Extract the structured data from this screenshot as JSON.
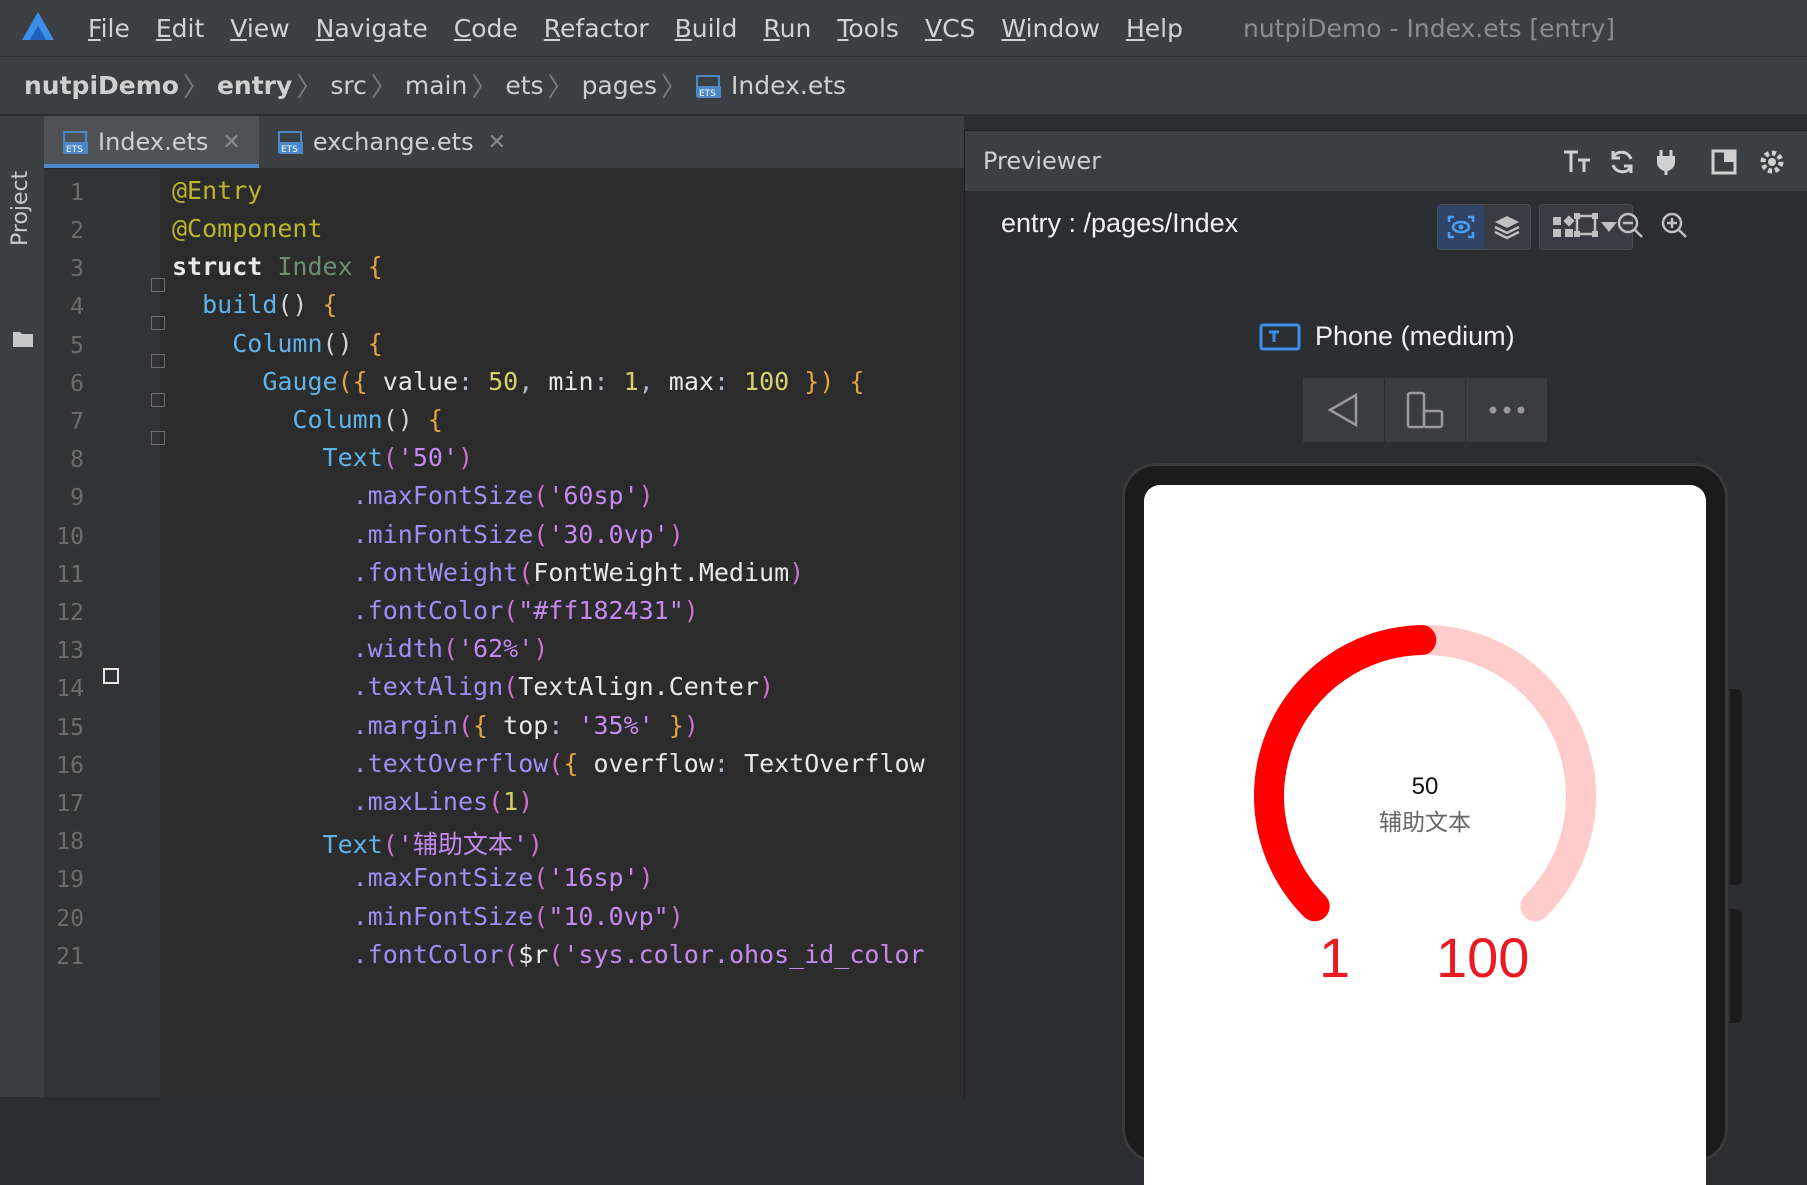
{
  "menu": {
    "items": [
      "File",
      "Edit",
      "View",
      "Navigate",
      "Code",
      "Refactor",
      "Build",
      "Run",
      "Tools",
      "VCS",
      "Window",
      "Help"
    ],
    "window_title": "nutpiDemo - Index.ets [entry]"
  },
  "breadcrumb": [
    "nutpiDemo",
    "entry",
    "src",
    "main",
    "ets",
    "pages",
    "Index.ets"
  ],
  "toolstrip": {
    "project_label": "Project"
  },
  "tabs": [
    {
      "label": "Index.ets",
      "active": true
    },
    {
      "label": "exchange.ets",
      "active": false
    }
  ],
  "editor": {
    "line_numbers": [
      "1",
      "2",
      "3",
      "4",
      "5",
      "6",
      "7",
      "8",
      "9",
      "10",
      "11",
      "12",
      "13",
      "14",
      "15",
      "16",
      "17",
      "18",
      "19",
      "20",
      "21"
    ]
  },
  "previewer": {
    "title": "Previewer",
    "route": "entry : /pages/Index",
    "device": "Phone (medium)",
    "gauge": {
      "value": 50,
      "min": 1,
      "max": 100,
      "value_text": "50",
      "aux_text": "辅助文本",
      "min_text": "1",
      "max_text": "100",
      "track_color": "#ffcccc",
      "progress_color": "#ff0000"
    }
  },
  "colors": {
    "accent": "#4a88c7",
    "gauge_red": "#ff0000",
    "gauge_light": "#ffcccc",
    "text_red": "#e81a22"
  }
}
